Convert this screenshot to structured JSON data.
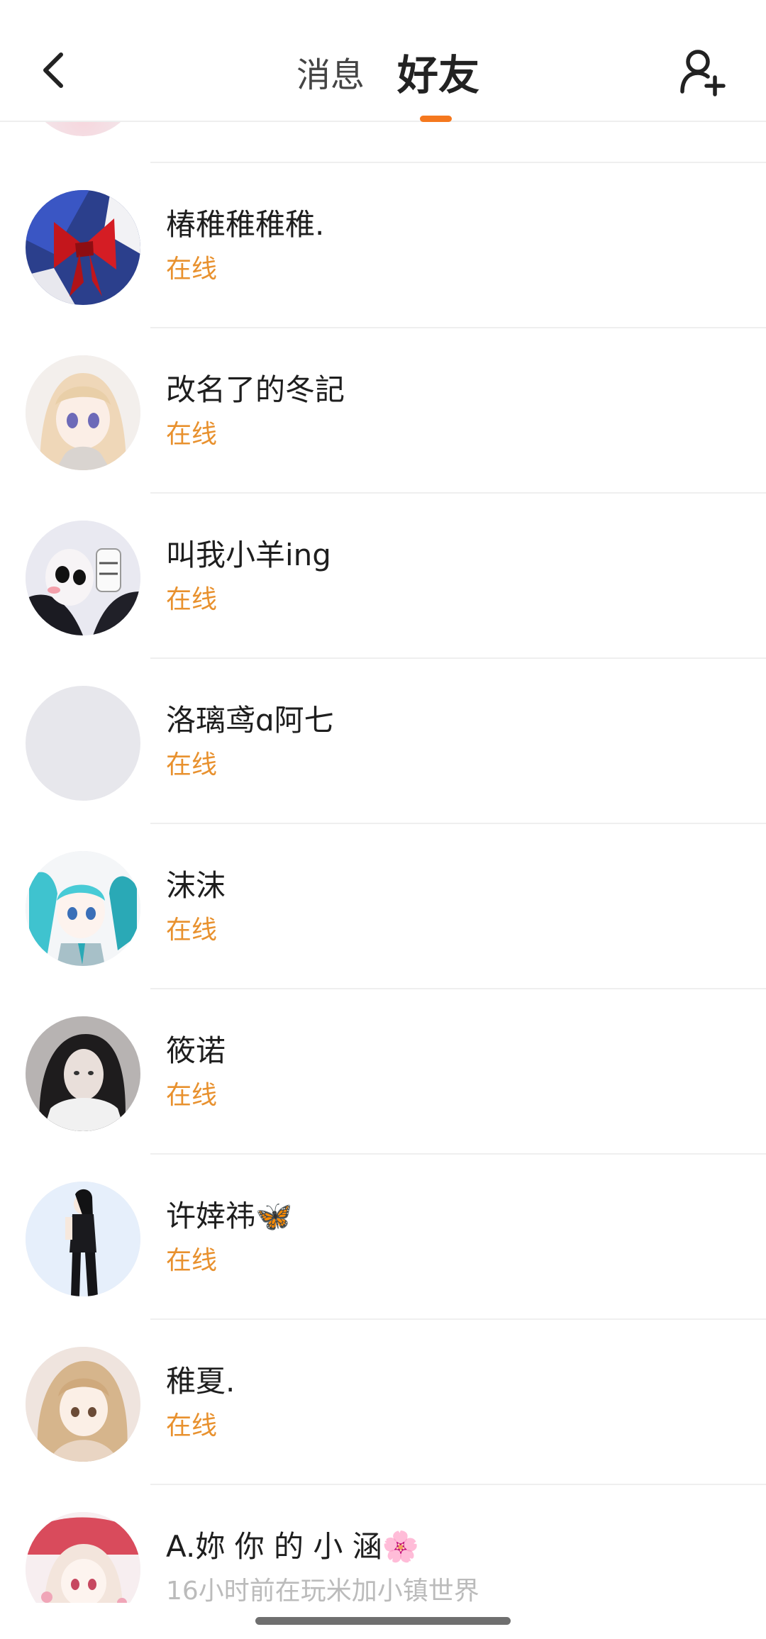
{
  "header": {
    "tabs": [
      {
        "label": "消息"
      },
      {
        "label": "好友"
      }
    ],
    "active_tab": "好友",
    "accent_color": "#f5781e"
  },
  "friends": [
    {
      "name": "椿稚稚稚稚.",
      "status": "在线",
      "avatar": "red-bow"
    },
    {
      "name": "改名了的冬記",
      "status": "在线",
      "avatar": "anime-girl-blonde"
    },
    {
      "name": "叫我小羊ing",
      "status": "在线",
      "avatar": "masked-figure"
    },
    {
      "name": "洛璃鸢ɑ阿七",
      "status": "在线",
      "avatar": "blank-gray"
    },
    {
      "name": "沫沫",
      "status": "在线",
      "avatar": "anime-girl-teal"
    },
    {
      "name": "筱诺",
      "status": "在线",
      "avatar": "photo-girl-dark-hair"
    },
    {
      "name": "许婞祎🦋",
      "status": "在线",
      "avatar": "anime-figure-black"
    },
    {
      "name": "稚夏.",
      "status": "在线",
      "avatar": "anime-girl-beige"
    },
    {
      "name": "A.妳  你 的 小 涵🌸",
      "status": "16小时前在玩米加小镇世界",
      "avatar": "anime-girl-pink"
    }
  ],
  "status_color": "#e8912e"
}
